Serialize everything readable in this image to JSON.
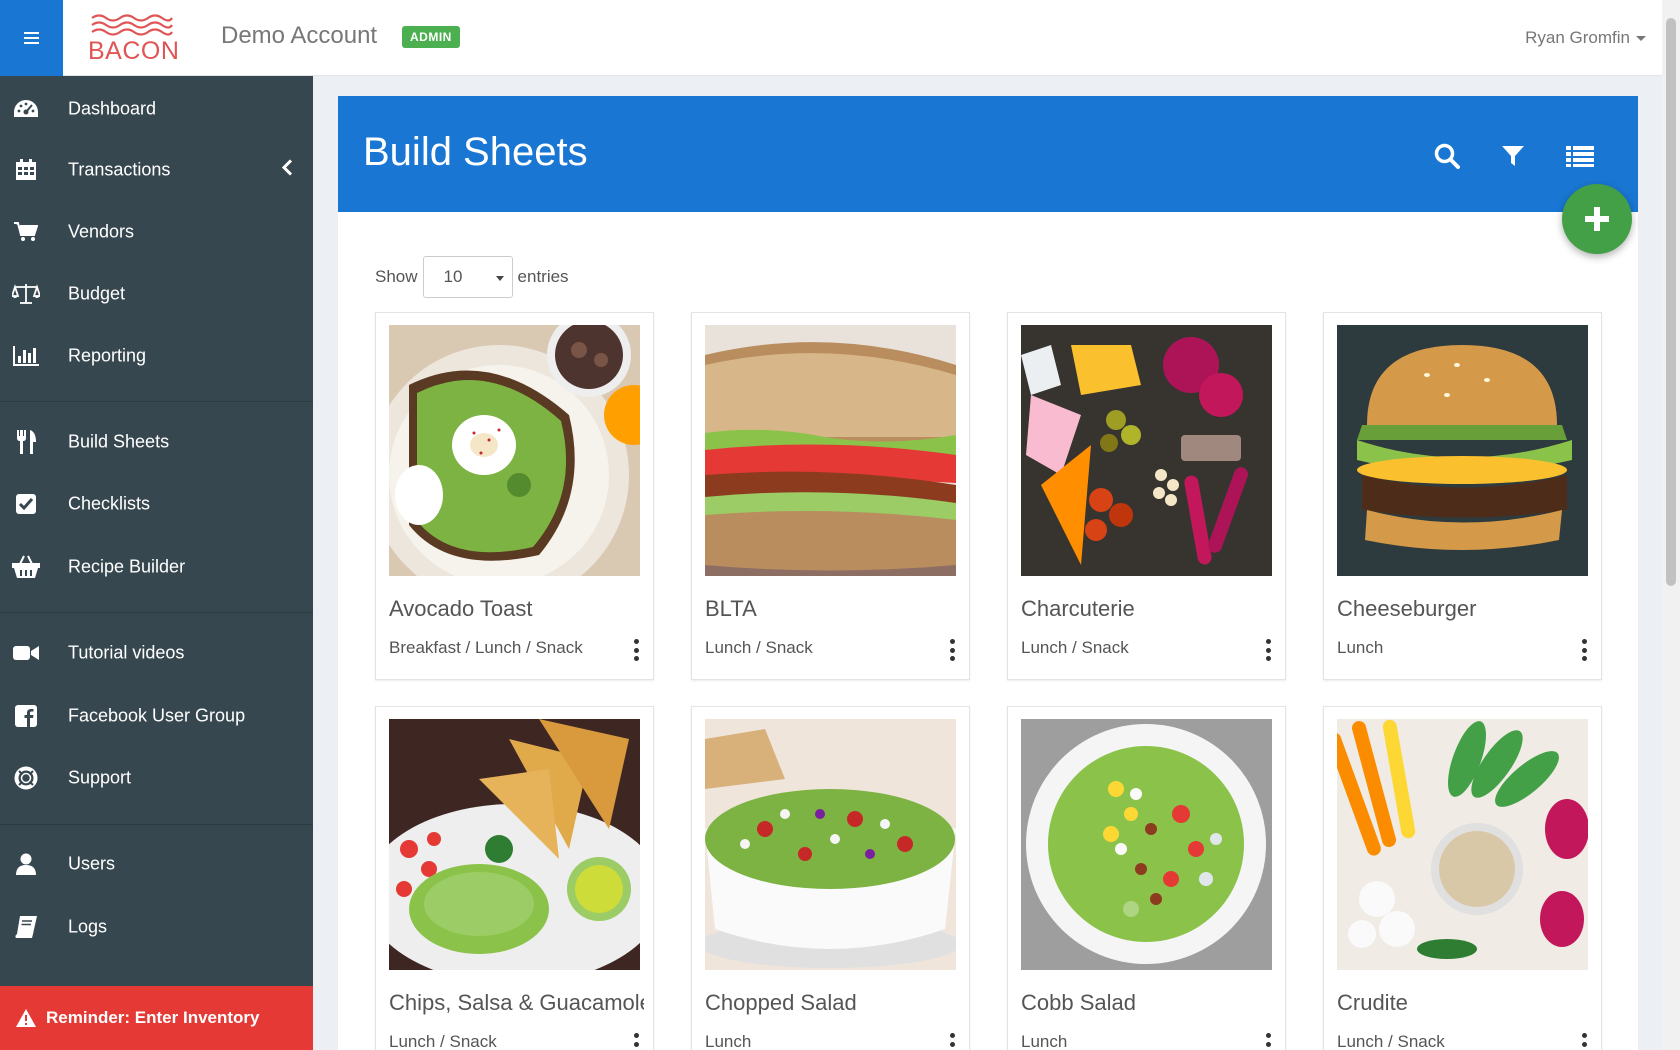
{
  "header": {
    "logo_text": "BACON",
    "account_name": "Demo Account",
    "admin_badge": "ADMIN",
    "user_name": "Ryan Gromfin"
  },
  "sidebar": {
    "items": [
      {
        "label": "Dashboard",
        "icon": "tachometer-icon"
      },
      {
        "label": "Transactions",
        "icon": "calendar-icon"
      },
      {
        "label": "Vendors",
        "icon": "shopping-cart-icon"
      },
      {
        "label": "Budget",
        "icon": "balance-scale-icon"
      },
      {
        "label": "Reporting",
        "icon": "bar-chart-icon"
      },
      {
        "label": "Build Sheets",
        "icon": "utensils-icon"
      },
      {
        "label": "Checklists",
        "icon": "check-square-icon"
      },
      {
        "label": "Recipe Builder",
        "icon": "basket-icon"
      },
      {
        "label": "Tutorial videos",
        "icon": "video-camera-icon"
      },
      {
        "label": "Facebook User Group",
        "icon": "facebook-icon"
      },
      {
        "label": "Support",
        "icon": "life-ring-icon"
      },
      {
        "label": "Users",
        "icon": "user-icon"
      },
      {
        "label": "Logs",
        "icon": "book-icon"
      }
    ],
    "reminder": "Reminder: Enter Inventory"
  },
  "main": {
    "title": "Build Sheets",
    "show_label": "Show",
    "entries_value": "10",
    "entries_label": "entries",
    "cards": [
      {
        "title": "Avocado Toast",
        "category": "Breakfast / Lunch / Snack"
      },
      {
        "title": "BLTA",
        "category": "Lunch / Snack"
      },
      {
        "title": "Charcuterie",
        "category": "Lunch / Snack"
      },
      {
        "title": "Cheeseburger",
        "category": "Lunch"
      },
      {
        "title": "Chips, Salsa & Guacamole",
        "category": "Lunch / Snack"
      },
      {
        "title": "Chopped Salad",
        "category": "Lunch"
      },
      {
        "title": "Cobb Salad",
        "category": "Lunch"
      },
      {
        "title": "Crudite",
        "category": "Lunch / Snack"
      }
    ]
  },
  "colors": {
    "primary": "#1976d2",
    "sidebar": "#37474f",
    "admin_badge": "#4caf50",
    "fab": "#43a047",
    "reminder": "#e53935",
    "logo": "#e05555"
  }
}
